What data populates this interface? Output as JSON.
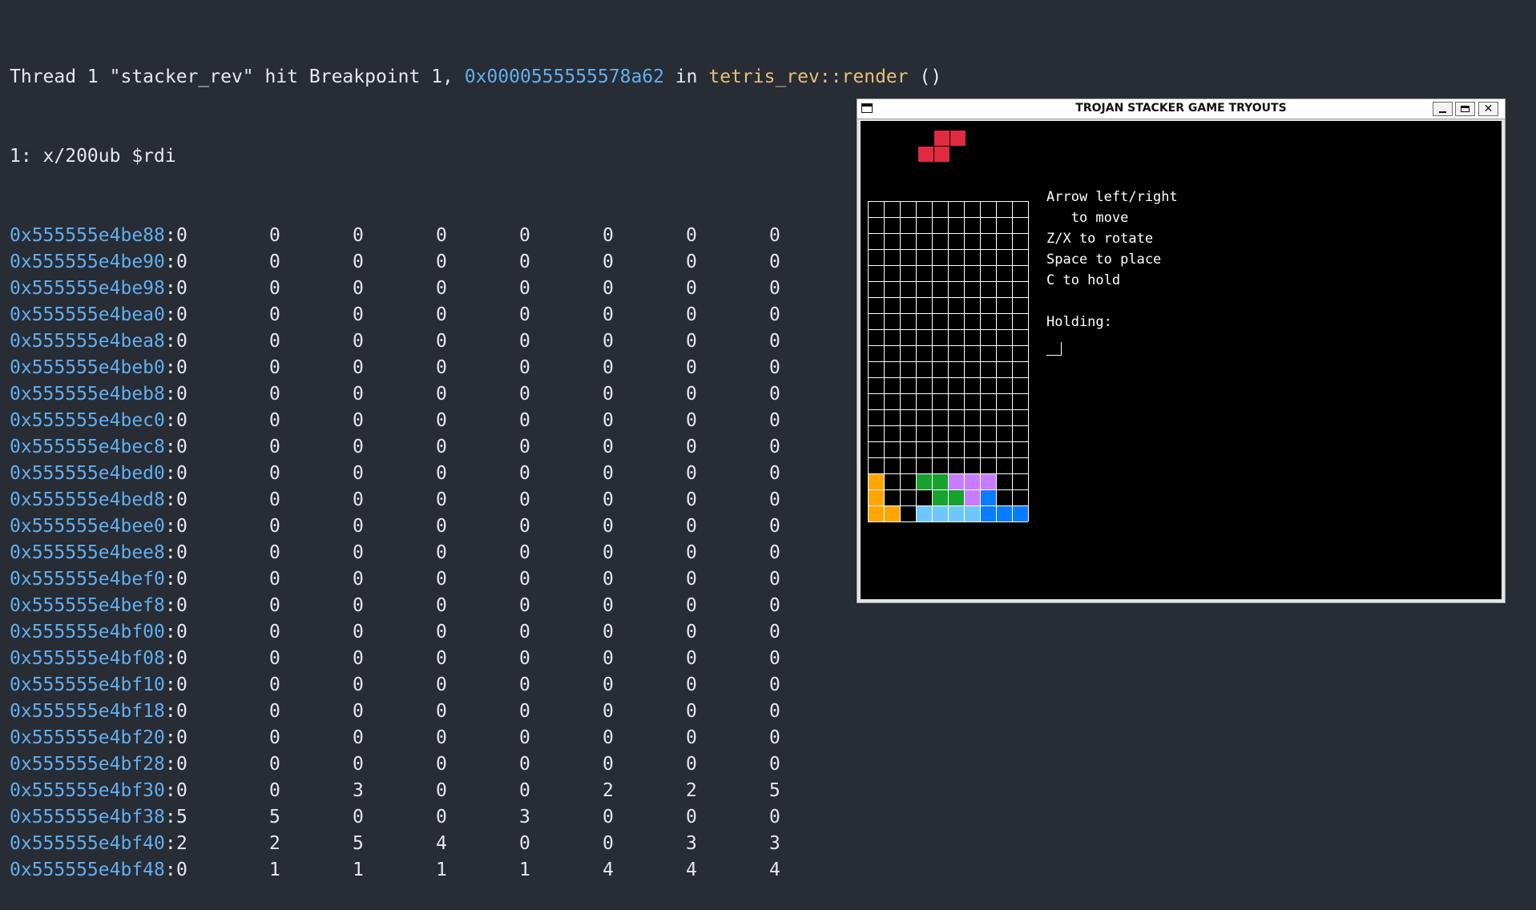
{
  "terminal": {
    "header": {
      "prefix": "Thread 1 \"stacker_rev\" hit Breakpoint 1, ",
      "address": "0x0000555555578a62",
      "mid": " in ",
      "function": "tetris_rev::render",
      "suffix": " ()"
    },
    "command": "1: x/200ub $rdi",
    "rows": [
      {
        "addr": "0x555555e4be88",
        "vals": [
          "0",
          "0",
          "0",
          "0",
          "0",
          "0",
          "0",
          "0"
        ]
      },
      {
        "addr": "0x555555e4be90",
        "vals": [
          "0",
          "0",
          "0",
          "0",
          "0",
          "0",
          "0",
          "0"
        ]
      },
      {
        "addr": "0x555555e4be98",
        "vals": [
          "0",
          "0",
          "0",
          "0",
          "0",
          "0",
          "0",
          "0"
        ]
      },
      {
        "addr": "0x555555e4bea0",
        "vals": [
          "0",
          "0",
          "0",
          "0",
          "0",
          "0",
          "0",
          "0"
        ]
      },
      {
        "addr": "0x555555e4bea8",
        "vals": [
          "0",
          "0",
          "0",
          "0",
          "0",
          "0",
          "0",
          "0"
        ]
      },
      {
        "addr": "0x555555e4beb0",
        "vals": [
          "0",
          "0",
          "0",
          "0",
          "0",
          "0",
          "0",
          "0"
        ]
      },
      {
        "addr": "0x555555e4beb8",
        "vals": [
          "0",
          "0",
          "0",
          "0",
          "0",
          "0",
          "0",
          "0"
        ]
      },
      {
        "addr": "0x555555e4bec0",
        "vals": [
          "0",
          "0",
          "0",
          "0",
          "0",
          "0",
          "0",
          "0"
        ]
      },
      {
        "addr": "0x555555e4bec8",
        "vals": [
          "0",
          "0",
          "0",
          "0",
          "0",
          "0",
          "0",
          "0"
        ]
      },
      {
        "addr": "0x555555e4bed0",
        "vals": [
          "0",
          "0",
          "0",
          "0",
          "0",
          "0",
          "0",
          "0"
        ]
      },
      {
        "addr": "0x555555e4bed8",
        "vals": [
          "0",
          "0",
          "0",
          "0",
          "0",
          "0",
          "0",
          "0"
        ]
      },
      {
        "addr": "0x555555e4bee0",
        "vals": [
          "0",
          "0",
          "0",
          "0",
          "0",
          "0",
          "0",
          "0"
        ]
      },
      {
        "addr": "0x555555e4bee8",
        "vals": [
          "0",
          "0",
          "0",
          "0",
          "0",
          "0",
          "0",
          "0"
        ]
      },
      {
        "addr": "0x555555e4bef0",
        "vals": [
          "0",
          "0",
          "0",
          "0",
          "0",
          "0",
          "0",
          "0"
        ]
      },
      {
        "addr": "0x555555e4bef8",
        "vals": [
          "0",
          "0",
          "0",
          "0",
          "0",
          "0",
          "0",
          "0"
        ]
      },
      {
        "addr": "0x555555e4bf00",
        "vals": [
          "0",
          "0",
          "0",
          "0",
          "0",
          "0",
          "0",
          "0"
        ]
      },
      {
        "addr": "0x555555e4bf08",
        "vals": [
          "0",
          "0",
          "0",
          "0",
          "0",
          "0",
          "0",
          "0"
        ]
      },
      {
        "addr": "0x555555e4bf10",
        "vals": [
          "0",
          "0",
          "0",
          "0",
          "0",
          "0",
          "0",
          "0"
        ]
      },
      {
        "addr": "0x555555e4bf18",
        "vals": [
          "0",
          "0",
          "0",
          "0",
          "0",
          "0",
          "0",
          "0"
        ]
      },
      {
        "addr": "0x555555e4bf20",
        "vals": [
          "0",
          "0",
          "0",
          "0",
          "0",
          "0",
          "0",
          "0"
        ]
      },
      {
        "addr": "0x555555e4bf28",
        "vals": [
          "0",
          "0",
          "0",
          "0",
          "0",
          "0",
          "0",
          "0"
        ]
      },
      {
        "addr": "0x555555e4bf30",
        "vals": [
          "0",
          "0",
          "3",
          "0",
          "0",
          "2",
          "2",
          "5"
        ]
      },
      {
        "addr": "0x555555e4bf38",
        "vals": [
          "5",
          "5",
          "0",
          "0",
          "3",
          "0",
          "0",
          "0"
        ]
      },
      {
        "addr": "0x555555e4bf40",
        "vals": [
          "2",
          "2",
          "5",
          "4",
          "0",
          "0",
          "3",
          "3"
        ]
      },
      {
        "addr": "0x555555e4bf48",
        "vals": [
          "0",
          "1",
          "1",
          "1",
          "1",
          "4",
          "4",
          "4"
        ]
      }
    ]
  },
  "window": {
    "title": "TROJAN STACKER GAME TRYOUTS",
    "help_lines": [
      "Arrow left/right",
      "   to move",
      "Z/X to rotate",
      "Space to place",
      "C to hold",
      "",
      "Holding:"
    ],
    "board": {
      "cols": 10,
      "rows": 20,
      "filled_rows": [
        {
          "row": 17,
          "cells": [
            "orange",
            "",
            "",
            "green",
            "green",
            "purple",
            "purple",
            "purple",
            "",
            ""
          ]
        },
        {
          "row": 18,
          "cells": [
            "orange",
            "",
            "",
            "",
            "green",
            "green",
            "purple",
            "blue",
            "",
            ""
          ]
        },
        {
          "row": 19,
          "cells": [
            "orange",
            "orange",
            "",
            "cyan",
            "cyan",
            "cyan",
            "cyan",
            "blue",
            "blue",
            "blue"
          ]
        }
      ]
    },
    "colors": {
      "orange": "#ffa500",
      "green": "#17a12f",
      "purple": "#c77dff",
      "blue": "#0a7cff",
      "cyan": "#6ec6ff",
      "red": "#e02b40"
    },
    "next_piece": {
      "name": "S",
      "color": "#e02b40"
    }
  }
}
